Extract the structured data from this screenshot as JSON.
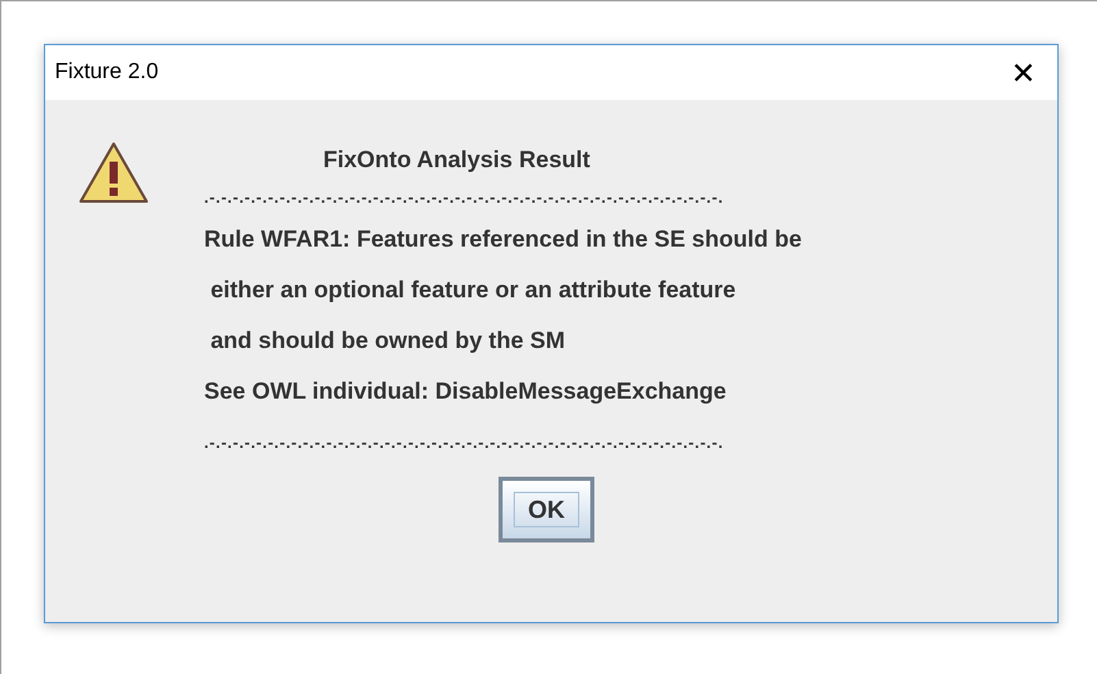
{
  "window": {
    "title": "Fixture 2.0",
    "close": "✕"
  },
  "message": {
    "heading": "FixOnto Analysis Result",
    "separator_top": ".-.-.-.-.-.-.-.-.-.-.-.-.-.-.-.-.-.-.-.-.-.-.-.-.-.-.-.-.-.-.-.-.-.-.-.-.-.-.-.-.-.-.-.-.",
    "lines": [
      "Rule WFAR1: Features referenced in the SE should be",
      " either an optional feature or an attribute feature",
      " and should be owned by the SM",
      "See OWL individual: DisableMessageExchange"
    ],
    "separator_bottom": ".-.-.-.-.-.-.-.-.-.-.-.-.-.-.-.-.-.-.-.-.-.-.-.-.-.-.-.-.-.-.-.-.-.-.-.-.-.-.-.-.-.-.-.-."
  },
  "buttons": [
    {
      "label": "OK",
      "focused": true
    }
  ]
}
